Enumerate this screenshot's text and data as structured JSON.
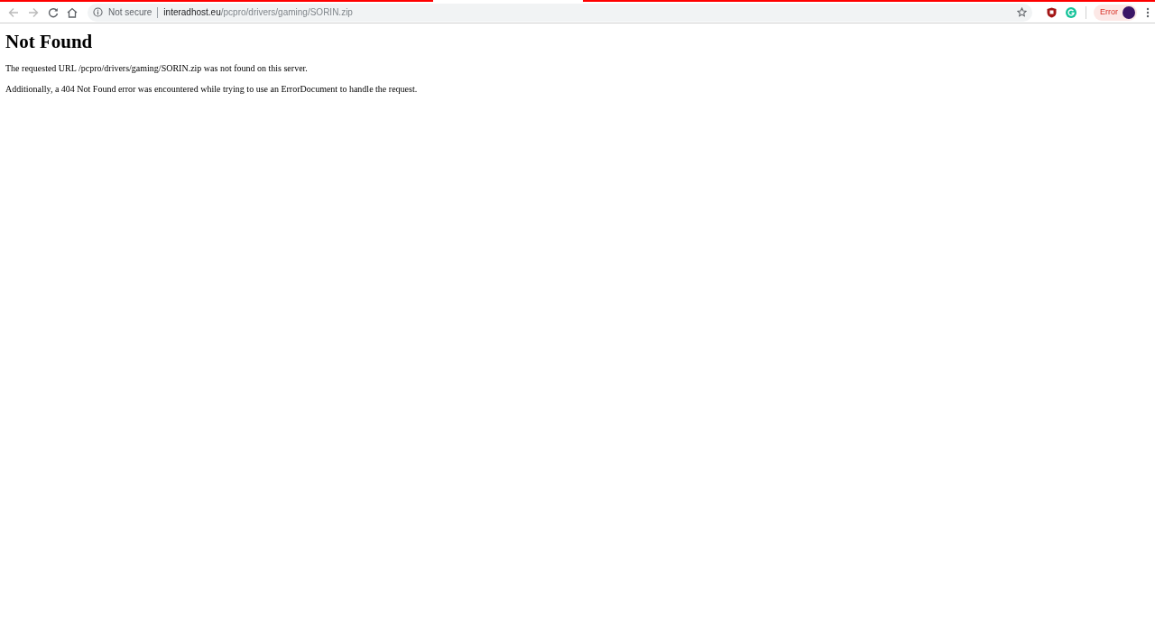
{
  "toolbar": {
    "security_label": "Not secure",
    "url_host": "interadhost.eu",
    "url_path": "/pcpro/drivers/gaming/SORIN.zip",
    "profile_status": "Error"
  },
  "page": {
    "heading": "Not Found",
    "paragraphs": [
      "The requested URL /pcpro/drivers/gaming/SORIN.zip was not found on this server.",
      "Additionally, a 404 Not Found error was encountered while trying to use an ErrorDocument to handle the request."
    ]
  }
}
